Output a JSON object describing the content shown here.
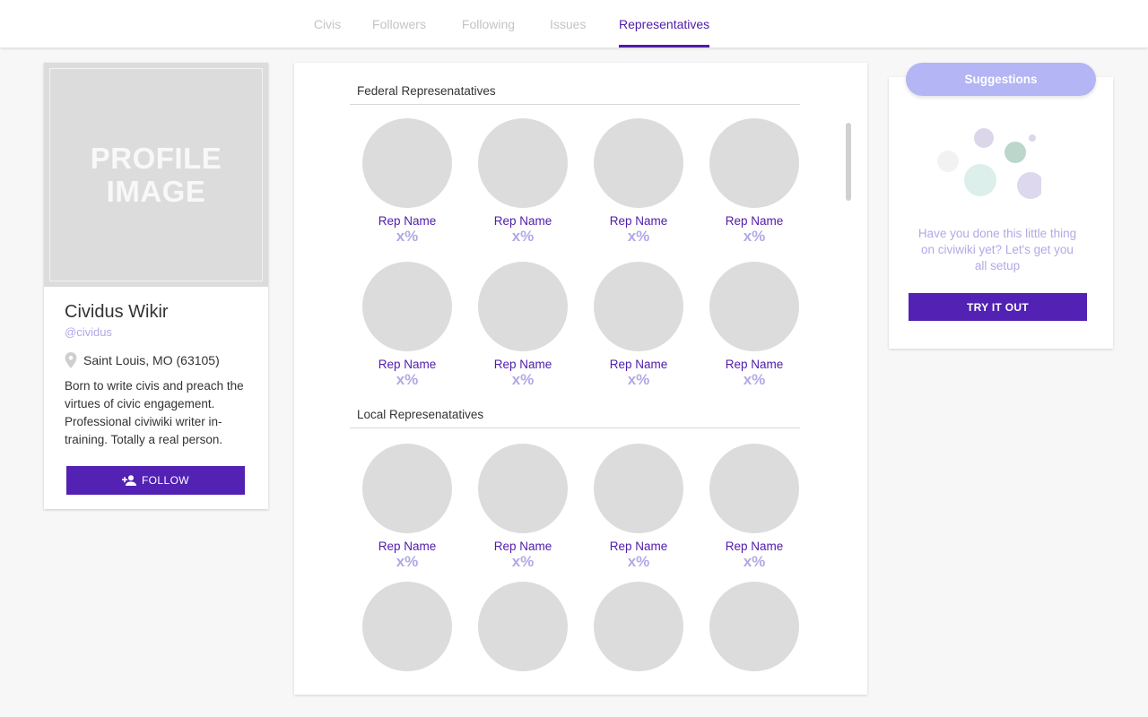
{
  "nav": {
    "tabs": [
      {
        "label": "Civis",
        "active": false
      },
      {
        "label": "Followers",
        "active": false
      },
      {
        "label": "Following",
        "active": false
      },
      {
        "label": "Issues",
        "active": false
      },
      {
        "label": "Representatives",
        "active": true
      }
    ]
  },
  "profile": {
    "image_placeholder_line1": "PROFILE",
    "image_placeholder_line2": "IMAGE",
    "name": "Cividus Wikir",
    "handle": "@cividus",
    "location": "Saint Louis, MO (63105)",
    "bio": "Born to write civis and preach the virtues of civic engagement. Professional civiwiki writer in-training. Totally a real person.",
    "follow_label": "FOLLOW"
  },
  "federal": {
    "title": "Federal Represenatatives",
    "reps": [
      {
        "name": "Rep Name",
        "pct": "x%"
      },
      {
        "name": "Rep Name",
        "pct": "x%"
      },
      {
        "name": "Rep Name",
        "pct": "x%"
      },
      {
        "name": "Rep Name",
        "pct": "x%"
      },
      {
        "name": "Rep Name",
        "pct": "x%"
      },
      {
        "name": "Rep Name",
        "pct": "x%"
      },
      {
        "name": "Rep Name",
        "pct": "x%"
      },
      {
        "name": "Rep Name",
        "pct": "x%"
      }
    ]
  },
  "local": {
    "title": "Local Represenatatives",
    "reps": [
      {
        "name": "Rep Name",
        "pct": "x%"
      },
      {
        "name": "Rep Name",
        "pct": "x%"
      },
      {
        "name": "Rep Name",
        "pct": "x%"
      },
      {
        "name": "Rep Name",
        "pct": "x%"
      }
    ]
  },
  "suggestions": {
    "title": "Suggestions",
    "text": "Have you done this little thing on civiwiki yet? Let's get you all setup",
    "button_label": "TRY IT OUT"
  },
  "colors": {
    "accent": "#4f1bab",
    "button": "#5321b4",
    "muted_accent": "#b1a9e6",
    "pill": "#b3b5f5",
    "placeholder": "#dcdcdc"
  }
}
